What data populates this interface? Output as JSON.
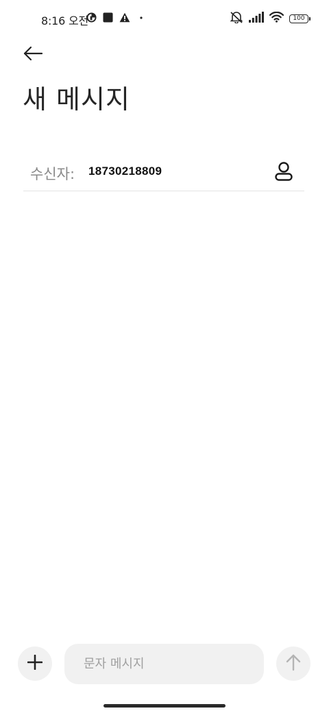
{
  "status_bar": {
    "time": "8:16 오전",
    "battery": "100",
    "left_icons": [
      "data-saver-icon",
      "square-notification-icon",
      "warning-icon",
      "dot-icon"
    ],
    "right_icons": [
      "mute-vibrate-icon",
      "signal-icon",
      "wifi-icon",
      "battery-icon"
    ]
  },
  "header": {
    "back_icon": "back-arrow-icon",
    "title": "새 메시지"
  },
  "recipient": {
    "label": "수신자:",
    "value": "18730218809",
    "contact_icon": "contact-person-icon"
  },
  "composer": {
    "add_icon": "plus-icon",
    "placeholder": "문자 메시지",
    "value": "",
    "send_icon": "send-arrow-up-icon"
  },
  "colors": {
    "background": "#ffffff",
    "pill_background": "#f1f1f1",
    "label_gray": "#8a8a8a",
    "divider": "#e3e3e3"
  }
}
